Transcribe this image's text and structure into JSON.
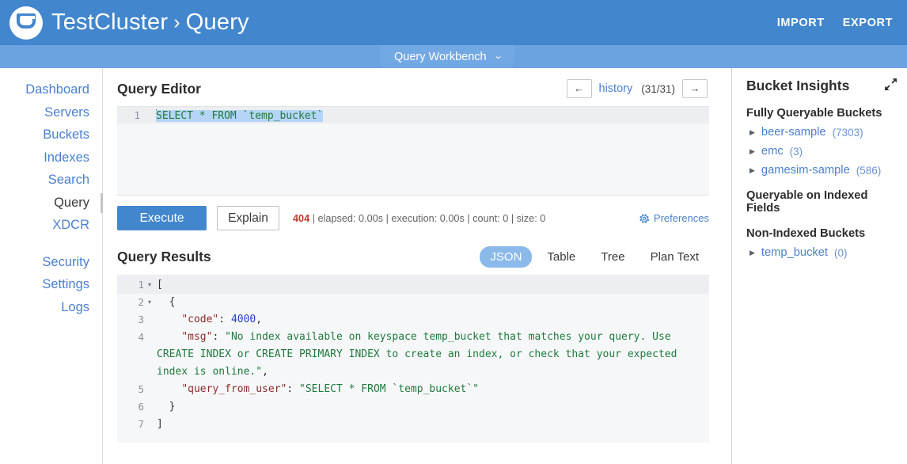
{
  "header": {
    "logo_icon": "couchbase-logo-icon",
    "cluster_name": "TestCluster",
    "separator": "›",
    "section": "Query",
    "import_label": "IMPORT",
    "export_label": "EXPORT",
    "bg_color": "#4286ce"
  },
  "subbar": {
    "tab_label": "Query Workbench",
    "caret_icon": "chevron-down-icon",
    "bg_color": "#6ba2e0"
  },
  "sidebar": {
    "items": [
      {
        "label": "Dashboard",
        "active": false
      },
      {
        "label": "Servers",
        "active": false
      },
      {
        "label": "Buckets",
        "active": false
      },
      {
        "label": "Indexes",
        "active": false
      },
      {
        "label": "Search",
        "active": false
      },
      {
        "label": "Query",
        "active": true
      },
      {
        "label": "XDCR",
        "active": false
      }
    ],
    "items2": [
      {
        "label": "Security",
        "active": false
      },
      {
        "label": "Settings",
        "active": false
      },
      {
        "label": "Logs",
        "active": false
      }
    ]
  },
  "editor": {
    "title": "Query Editor",
    "prev_arrow": "←",
    "history_label": "history",
    "history_count": "(31/31)",
    "next_arrow": "→",
    "line_number": "1",
    "query_text": "SELECT * FROM `temp_bucket`"
  },
  "actions": {
    "execute_label": "Execute",
    "explain_label": "Explain",
    "status_code": "404",
    "status_detail": "| elapsed: 0.00s | execution: 0.00s | count: 0 | size: 0",
    "preferences_label": "Preferences",
    "gear_icon": "gear-icon"
  },
  "results": {
    "title": "Query Results",
    "tabs": [
      {
        "label": "JSON",
        "active": true
      },
      {
        "label": "Table",
        "active": false
      },
      {
        "label": "Tree",
        "active": false
      },
      {
        "label": "Plan Text",
        "active": false
      }
    ],
    "lines": [
      {
        "n": "1",
        "fold": "▾",
        "highlight": true,
        "text": "["
      },
      {
        "n": "2",
        "fold": "▾",
        "highlight": false,
        "text": "  {"
      },
      {
        "n": "3",
        "fold": "",
        "highlight": false,
        "text": "    \"code\": 4000,"
      },
      {
        "n": "4",
        "fold": "",
        "highlight": false,
        "text": "    \"msg\": \"No index available on keyspace temp_bucket that matches your query. Use CREATE INDEX or CREATE PRIMARY INDEX to create an index, or check that your expected index is online.\","
      },
      {
        "n": "5",
        "fold": "",
        "highlight": false,
        "text": "    \"query_from_user\": \"SELECT * FROM `temp_bucket`\""
      },
      {
        "n": "6",
        "fold": "",
        "highlight": false,
        "text": "  }"
      },
      {
        "n": "7",
        "fold": "",
        "highlight": false,
        "text": "]"
      }
    ],
    "error_code_value": "4000",
    "error_msg_value": "No index available on keyspace temp_bucket that matches your query. Use CREATE INDEX or CREATE PRIMARY INDEX to create an index, or check that your expected index is online.",
    "query_from_user_value": "SELECT * FROM `temp_bucket`"
  },
  "insights": {
    "title": "Bucket Insights",
    "expand_icon": "expand-diagonal-icon",
    "group_fully_queryable": "Fully Queryable Buckets",
    "fully_queryable": [
      {
        "name": "beer-sample",
        "count": "(7303)"
      },
      {
        "name": "emc",
        "count": "(3)"
      },
      {
        "name": "gamesim-sample",
        "count": "(586)"
      }
    ],
    "group_indexed_fields": "Queryable on Indexed Fields",
    "indexed_fields": [],
    "group_non_indexed": "Non-Indexed Buckets",
    "non_indexed": [
      {
        "name": "temp_bucket",
        "count": "(0)"
      }
    ],
    "disclosure_icon": "triangle-right-icon"
  }
}
